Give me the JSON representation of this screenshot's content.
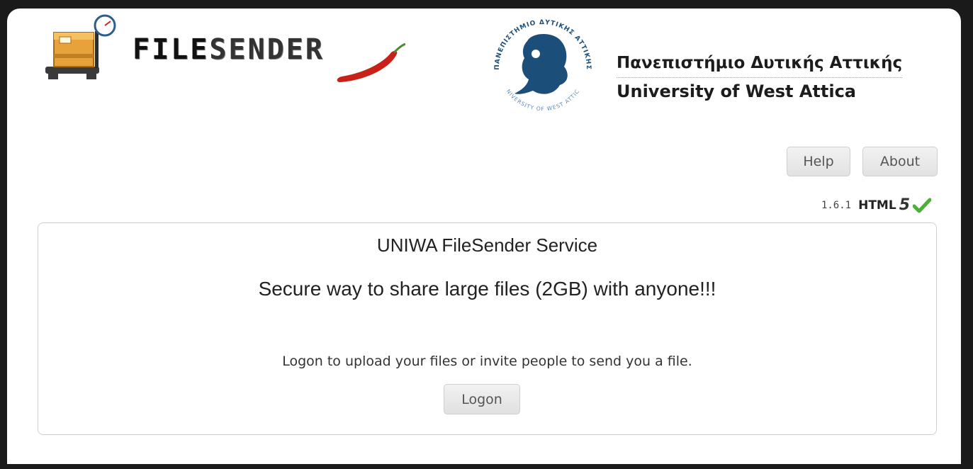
{
  "header": {
    "logo": {
      "word_bold": "FILE",
      "word_light": "SENDER"
    },
    "university": {
      "name_greek": "Πανεπιστήμιο Δυτικής Αττικής",
      "name_english": "University of West Attica",
      "seal_text_top": "ΠΑΝΕΠΙΣΤΗΜΙΟ ΔΥΤΙΚΗΣ ΑΤΤΙΚΗΣ",
      "seal_text_bottom": "UNIVERSITY OF WEST ATTICA"
    }
  },
  "menu": {
    "help_label": "Help",
    "about_label": "About"
  },
  "version": {
    "number": "1.6.1",
    "html_label": "HTML",
    "html_version": "5"
  },
  "main": {
    "title": "UNIWA FileSender Service",
    "tagline": "Secure way to share large files (2GB) with anyone!!!",
    "logon_text": "Logon to upload your files or invite people to send you a file.",
    "logon_button": "Logon"
  },
  "colors": {
    "seal_blue": "#1b4f7a",
    "chili_red": "#c9201a",
    "check_green": "#4caf3a",
    "box_orange": "#e8a23a"
  },
  "icons": [
    "filesender-logo-icon",
    "chili-pepper-icon",
    "university-seal-icon",
    "checkmark-icon"
  ]
}
